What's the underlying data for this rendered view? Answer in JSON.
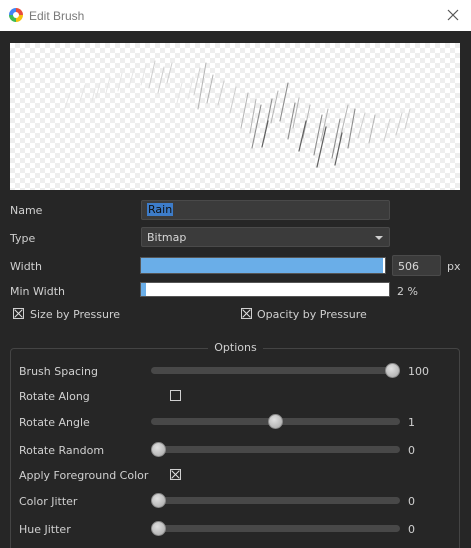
{
  "window": {
    "title": "Edit Brush",
    "close_icon": "close-icon"
  },
  "form": {
    "name_label": "Name",
    "name_value": "Rain",
    "type_label": "Type",
    "type_value": "Bitmap",
    "width_label": "Width",
    "width_value": "506",
    "width_unit": "px",
    "width_fraction": 0.99,
    "minwidth_label": "Min Width",
    "minwidth_value": "2 %",
    "minwidth_fraction": 0.02,
    "size_by_pressure": {
      "label": "Size by Pressure",
      "checked": true
    },
    "opacity_by_pressure": {
      "label": "Opacity by Pressure",
      "checked": true
    }
  },
  "options": {
    "title": "Options",
    "rows": [
      {
        "label": "Brush Spacing",
        "kind": "slider",
        "value": "100",
        "fraction": 1.0
      },
      {
        "label": "Rotate Along",
        "kind": "checkbox",
        "checked": false
      },
      {
        "label": "Rotate Angle",
        "kind": "slider",
        "value": "1",
        "fraction": 0.5
      },
      {
        "label": "Rotate Random",
        "kind": "slider",
        "value": "0",
        "fraction": 0.0
      },
      {
        "label": "Apply Foreground Color",
        "kind": "checkbox",
        "checked": true
      },
      {
        "label": "Color Jitter",
        "kind": "slider",
        "value": "0",
        "fraction": 0.0
      },
      {
        "label": "Hue Jitter",
        "kind": "slider",
        "value": "0",
        "fraction": 0.0
      }
    ]
  }
}
